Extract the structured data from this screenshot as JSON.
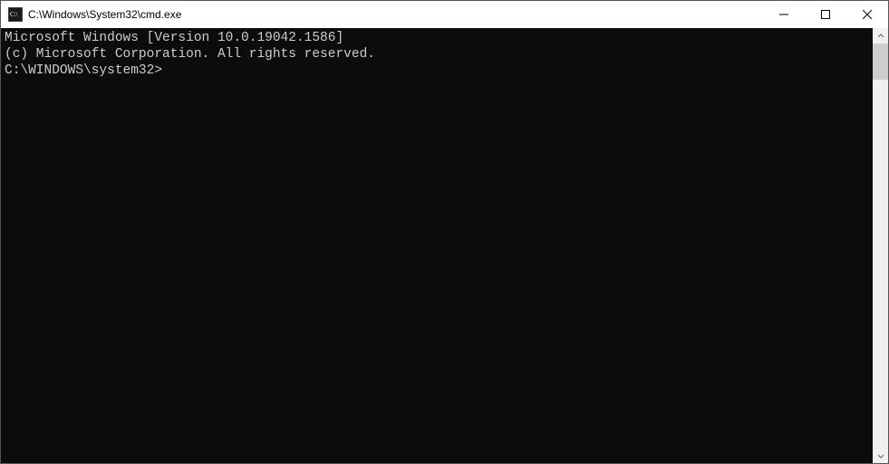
{
  "window": {
    "title": "C:\\Windows\\System32\\cmd.exe"
  },
  "console": {
    "line1": "Microsoft Windows [Version 10.0.19042.1586]",
    "line2": "(c) Microsoft Corporation. All rights reserved.",
    "blank": "",
    "prompt": "C:\\WINDOWS\\system32>"
  }
}
